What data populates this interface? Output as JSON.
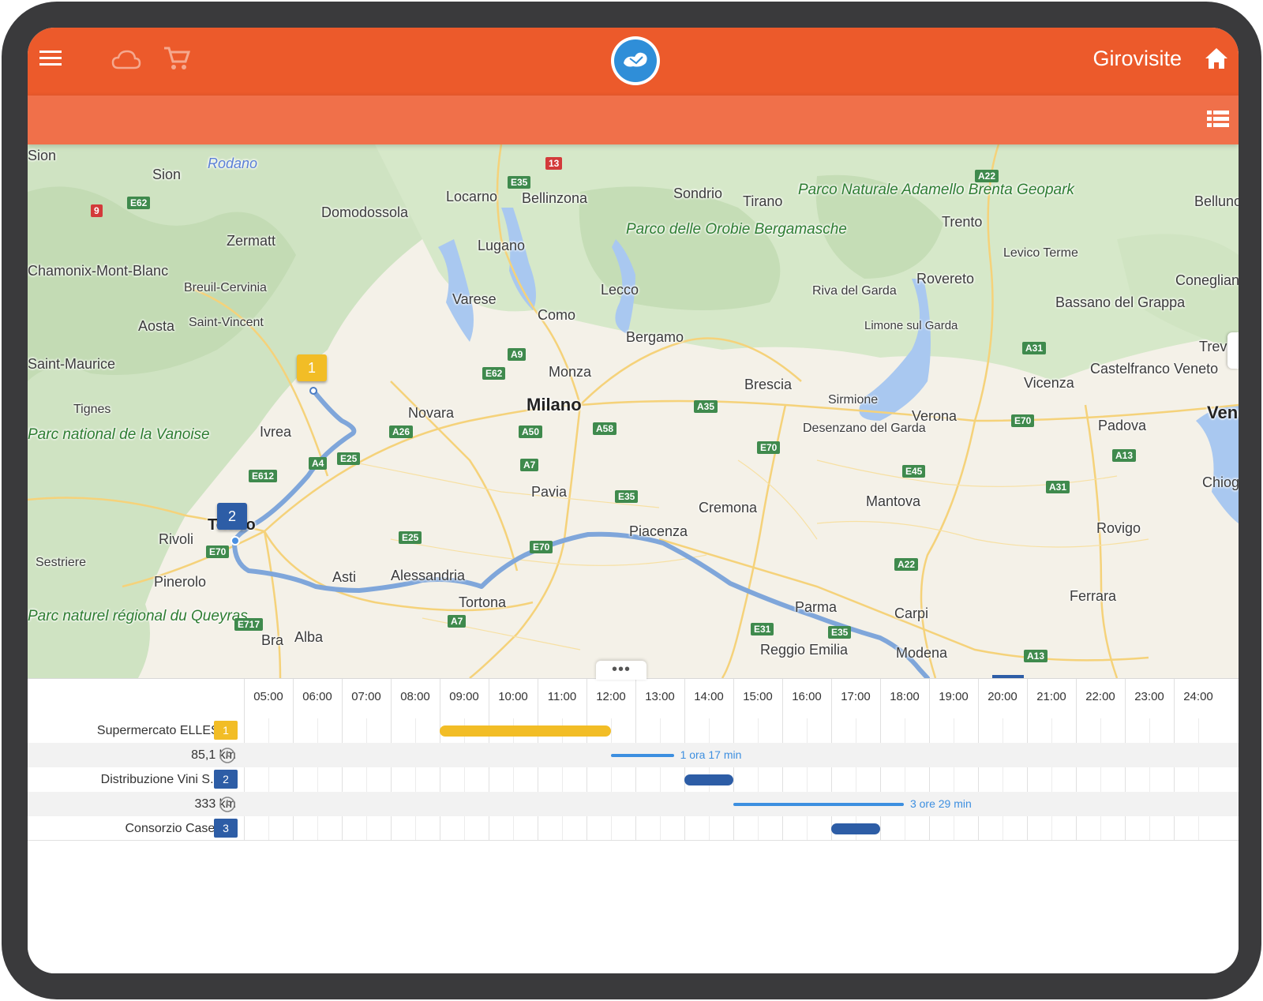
{
  "header": {
    "app_title": "Girovisite",
    "menu_icon": "hamburger-menu-icon",
    "cloud_icon": "cloud-icon",
    "cart_icon": "shopping-cart-icon",
    "logo_icon": "bird-logo-icon",
    "home_icon": "home-icon",
    "list_icon": "list-view-icon"
  },
  "colors": {
    "topbar": "#ec5a2b",
    "subbar": "#f0704a",
    "route": "#7fa6da",
    "stop_yellow": "#f2bd26",
    "stop_blue": "#2d5da6",
    "travel_line": "#3d8fe0"
  },
  "map": {
    "cities": [
      {
        "name": "Sion"
      },
      {
        "name": "Rodano"
      },
      {
        "name": "Zermatt"
      },
      {
        "name": "Domodossola"
      },
      {
        "name": "Locarno"
      },
      {
        "name": "Bellinzona"
      },
      {
        "name": "Sondrio"
      },
      {
        "name": "Tirano"
      },
      {
        "name": "Parco Naturale Adamello Brenta Geopark"
      },
      {
        "name": "Belluno"
      },
      {
        "name": "Trento"
      },
      {
        "name": "Lugano"
      },
      {
        "name": "Parco delle Orobie Bergamasche"
      },
      {
        "name": "Lecco"
      },
      {
        "name": "Levico Terme"
      },
      {
        "name": "Chamonix-Mont-Blanc"
      },
      {
        "name": "Breuil-Cervinia"
      },
      {
        "name": "Varese"
      },
      {
        "name": "Como"
      },
      {
        "name": "Riva del Garda"
      },
      {
        "name": "Rovereto"
      },
      {
        "name": "Conegliano"
      },
      {
        "name": "Aosta"
      },
      {
        "name": "Saint-Vincent"
      },
      {
        "name": "Bergamo"
      },
      {
        "name": "Limone sul Garda"
      },
      {
        "name": "Bassano del Grappa"
      },
      {
        "name": "Treviso"
      },
      {
        "name": "Saint-Maurice"
      },
      {
        "name": "Monza"
      },
      {
        "name": "Brescia"
      },
      {
        "name": "Vicenza"
      },
      {
        "name": "Castelfranco Veneto"
      },
      {
        "name": "Tignes"
      },
      {
        "name": "Novara"
      },
      {
        "name": "Milano"
      },
      {
        "name": "Sirmione"
      },
      {
        "name": "Verona"
      },
      {
        "name": "Venezia"
      },
      {
        "name": "Ivrea"
      },
      {
        "name": "Parc national de la Vanoise"
      },
      {
        "name": "Desenzano del Garda"
      },
      {
        "name": "Padova"
      },
      {
        "name": "Pavia"
      },
      {
        "name": "Chioggia"
      },
      {
        "name": "Mantova"
      },
      {
        "name": "Cremona"
      },
      {
        "name": "Torino"
      },
      {
        "name": "Rivoli"
      },
      {
        "name": "Piacenza"
      },
      {
        "name": "Rovigo"
      },
      {
        "name": "Sestriere"
      },
      {
        "name": "Asti"
      },
      {
        "name": "Alessandria"
      },
      {
        "name": "Pinerolo"
      },
      {
        "name": "Ferrara"
      },
      {
        "name": "Tortona"
      },
      {
        "name": "Parma"
      },
      {
        "name": "Carpi"
      },
      {
        "name": "Parc naturel régional du Queyras"
      },
      {
        "name": "Bra"
      },
      {
        "name": "Alba"
      },
      {
        "name": "Reggio Emilia"
      },
      {
        "name": "Modena"
      }
    ],
    "roads": [
      "E62",
      "9",
      "E35",
      "13",
      "A22",
      "A9",
      "E62",
      "A26",
      "A50",
      "A58",
      "A35",
      "A31",
      "E70",
      "E25",
      "A4",
      "E612",
      "A7",
      "E35",
      "E45",
      "A13",
      "A31",
      "E25",
      "E70",
      "E70",
      "A22",
      "E717",
      "A7",
      "E31",
      "E35",
      "A13",
      "E70"
    ],
    "markers": [
      {
        "label": "1",
        "color": "yellow"
      },
      {
        "label": "2",
        "color": "blue"
      }
    ]
  },
  "timeline": {
    "hours": [
      "05:00",
      "06:00",
      "07:00",
      "08:00",
      "09:00",
      "10:00",
      "11:00",
      "12:00",
      "13:00",
      "14:00",
      "15:00",
      "16:00",
      "17:00",
      "18:00",
      "19:00",
      "20:00",
      "21:00",
      "22:00",
      "23:00",
      "24:00"
    ],
    "rows": [
      {
        "type": "stop",
        "label": "Supermercato ELLESSE",
        "badge": "1",
        "color": "yellow",
        "start": "09:00",
        "end": "12:30"
      },
      {
        "type": "travel",
        "label": "85,1 km",
        "duration": "1 ora 17 min",
        "start": "12:30",
        "end": "13:47"
      },
      {
        "type": "stop",
        "label": "Distribuzione Vini S.p.A.",
        "badge": "2",
        "color": "blue",
        "start": "14:00",
        "end": "15:00"
      },
      {
        "type": "travel",
        "label": "333 km",
        "duration": "3 ore 29 min",
        "start": "15:00",
        "end": "18:29"
      },
      {
        "type": "stop",
        "label": "Consorzio Caseario",
        "badge": "3",
        "color": "blue",
        "start": "17:00",
        "end": "18:00"
      }
    ]
  }
}
